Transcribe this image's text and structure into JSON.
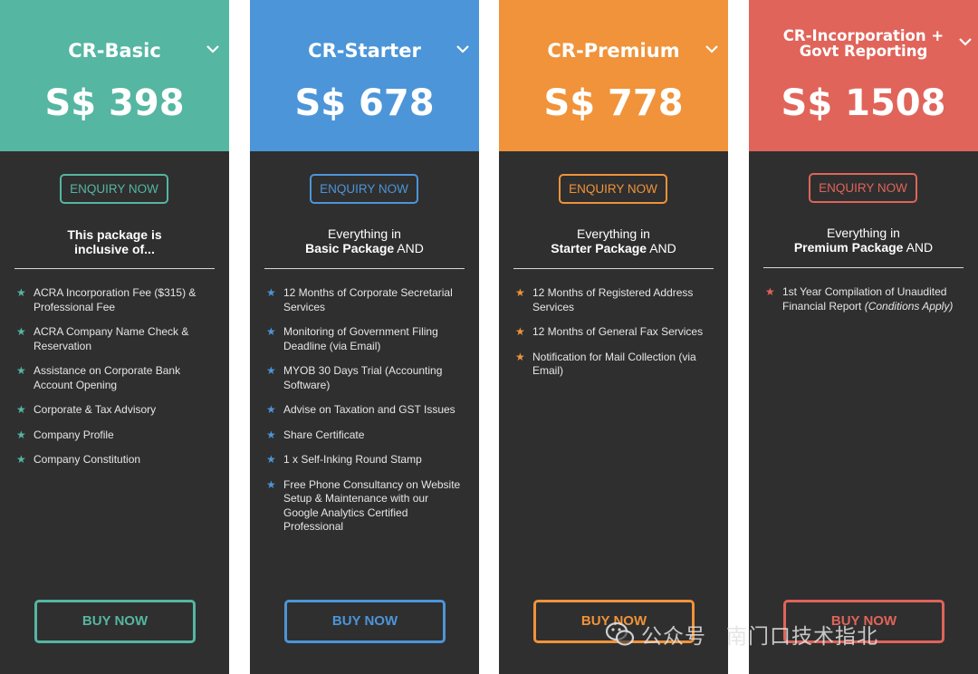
{
  "cards": [
    {
      "name": "CR-Basic",
      "price": "S$ 398",
      "color": "#55b6a2",
      "enquiry": "ENQUIRY NOW",
      "intro_line1": "This package is",
      "intro_line2": "inclusive of...",
      "features": [
        "ACRA Incorporation Fee ($315) & Professional Fee",
        "ACRA Company Name Check & Reservation",
        "Assistance on Corporate Bank Account Opening",
        "Corporate & Tax Advisory",
        "Company Profile",
        "Company Constitution"
      ],
      "buy": "BUY NOW"
    },
    {
      "name": "CR-Starter",
      "price": "S$ 678",
      "color": "#4c95d8",
      "enquiry": "ENQUIRY NOW",
      "intro_line1": "Everything in",
      "intro_bold": "Basic Package",
      "intro_tail": " AND",
      "features": [
        "12 Months of Corporate Secretarial Services",
        "Monitoring of Government Filing Deadline (via Email)",
        "MYOB 30 Days Trial (Accounting Software)",
        "Advise on Taxation and GST Issues",
        "Share Certificate",
        "1 x Self-Inking Round Stamp",
        "Free Phone Consultancy on Website Setup & Maintenance with our Google Analytics Certified Professional"
      ],
      "buy": "BUY NOW"
    },
    {
      "name": "CR-Premium",
      "price": "S$ 778",
      "color": "#f0933a",
      "enquiry": "ENQUIRY NOW",
      "intro_line1": "Everything in",
      "intro_bold": "Starter Package",
      "intro_tail": " AND",
      "features": [
        "12 Months of Registered Address Services",
        "12 Months of General Fax Services",
        "Notification for Mail Collection (via Email)"
      ],
      "buy": "BUY NOW"
    },
    {
      "name": "CR-Incorporation + Govt Reporting",
      "price": "S$ 1508",
      "color": "#e0645a",
      "enquiry": "ENQUIRY NOW",
      "intro_line1": "Everything in",
      "intro_bold": "Premium Package",
      "intro_tail": " AND",
      "features": [
        "1st Year Compilation of Unaudited Financial Report"
      ],
      "feature_note": "(Conditions Apply)",
      "buy": "BUY NOW"
    }
  ],
  "watermark": {
    "left": "公众号",
    "right": "南门口技术指北"
  }
}
